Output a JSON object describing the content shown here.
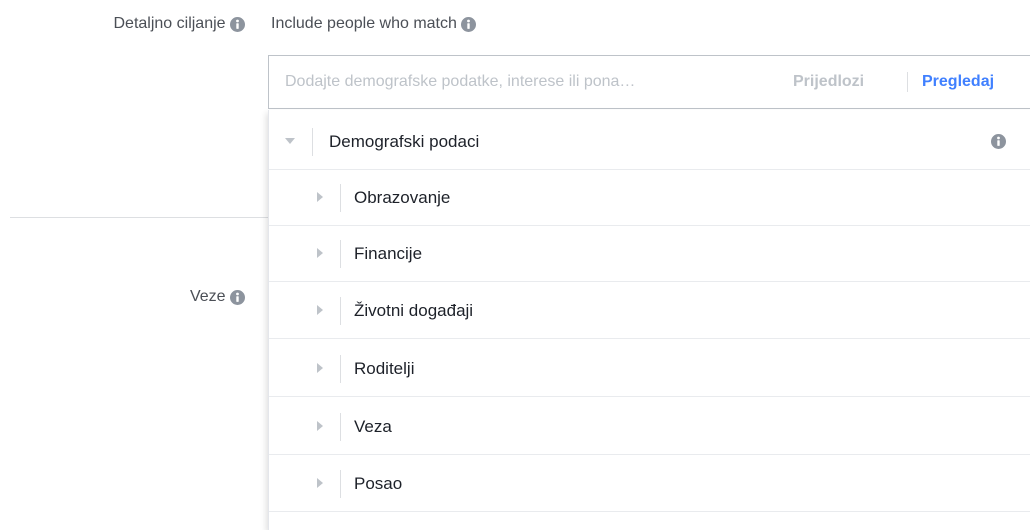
{
  "left_labels": {
    "detailed_targeting": "Detaljno ciljanje",
    "connections": "Veze"
  },
  "include": {
    "heading": "Include people who match"
  },
  "search": {
    "placeholder": "Dodajte demografske podatke, interese ili pona…",
    "suggestions_label": "Prijedlozi",
    "browse_label": "Pregledaj"
  },
  "categories": {
    "root": {
      "label": "Demografski podaci",
      "expanded": true
    },
    "children": [
      {
        "label": "Obrazovanje"
      },
      {
        "label": "Financije"
      },
      {
        "label": "Životni događaji"
      },
      {
        "label": "Roditelji"
      },
      {
        "label": "Veza"
      },
      {
        "label": "Posao"
      }
    ]
  },
  "icons": {
    "info": "info-icon",
    "expanded_caret": "caret-down-icon",
    "collapsed_caret": "caret-right-icon"
  },
  "colors": {
    "link_blue": "#4080ff",
    "muted_text": "#bec3c9",
    "label_text": "#4b4f56",
    "icon_gray": "#8d949e"
  }
}
